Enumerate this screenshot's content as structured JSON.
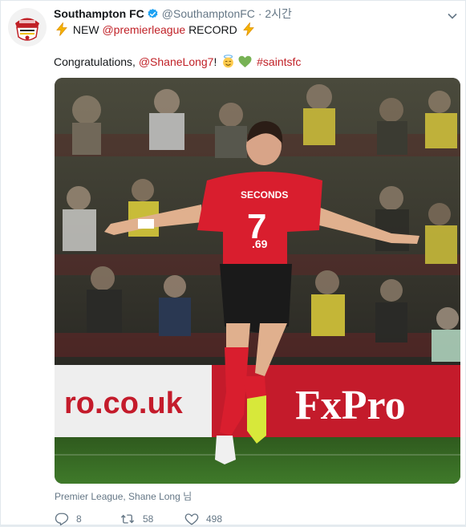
{
  "author": {
    "display_name": "Southampton FC",
    "handle": "@SouthamptonFC",
    "separator": "·",
    "time": "2시간",
    "verified_icon": "verified-badge-icon",
    "avatar_icon": "southampton-crest-icon"
  },
  "tweet": {
    "line1_prefix": "NEW",
    "line1_mention": "@premierleague",
    "line1_suffix": "RECORD",
    "line1_emoji": "lightning-emoji",
    "line2_prefix": "Congratulations,",
    "line2_mention": "@ShaneLong7",
    "line2_bang": "!",
    "line2_hashtag": "#saintsfc",
    "line2_emojis": [
      "smiling-halo-emoji",
      "green-heart-emoji"
    ]
  },
  "photo": {
    "shirt_name": "SECONDS",
    "shirt_number": "7",
    "shirt_time": ".69",
    "board_left": "ro.co.uk",
    "board_right": "FxPro"
  },
  "tags": "Premier League, Shane Long 님",
  "actions": {
    "reply_count": "8",
    "retweet_count": "58",
    "like_count": "498"
  },
  "colors": {
    "saints_red": "#c02026",
    "text_primary": "#14171a",
    "text_secondary": "#657786",
    "verified_blue": "#1da1f2"
  }
}
